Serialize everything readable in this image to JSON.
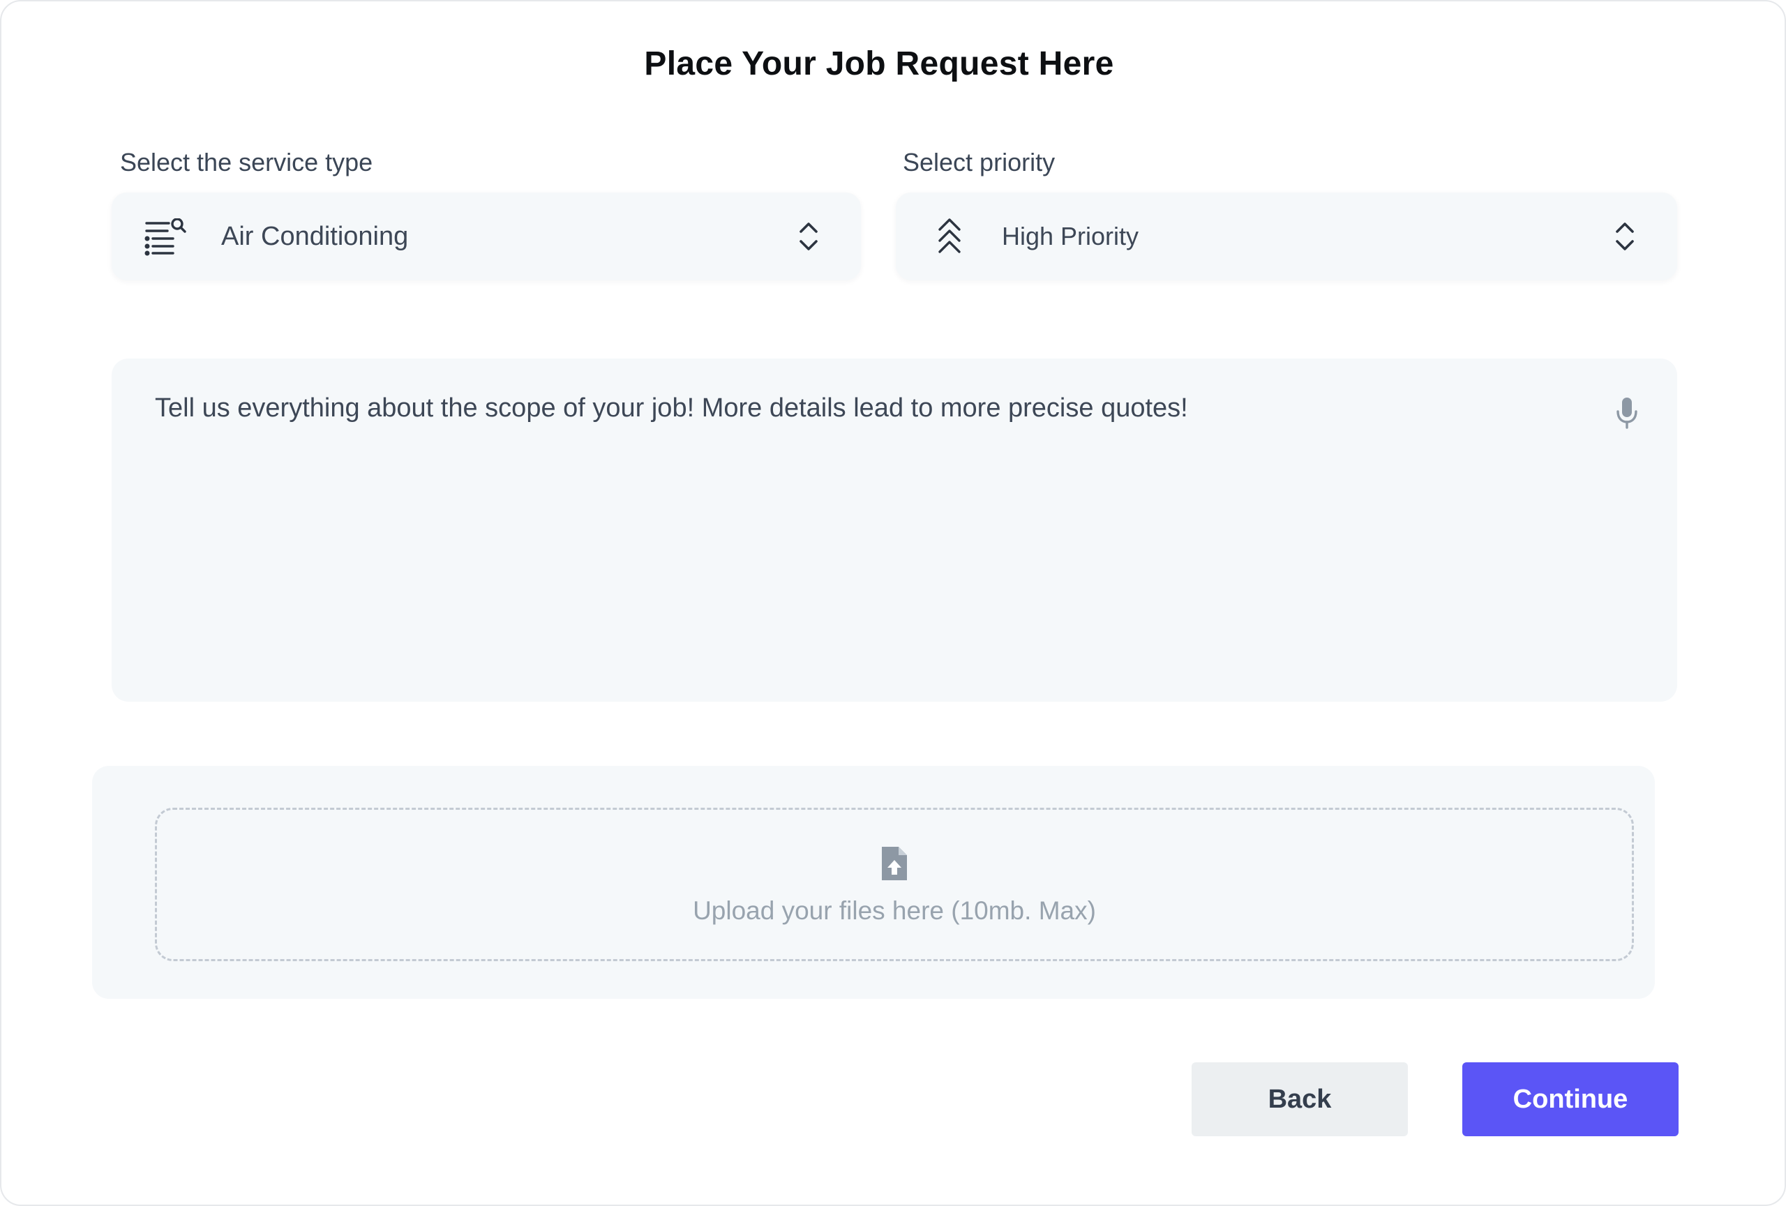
{
  "page": {
    "title": "Place Your Job Request Here"
  },
  "service_type": {
    "label": "Select the service type",
    "value": "Air Conditioning",
    "icon": "list-search-icon"
  },
  "priority": {
    "label": "Select priority",
    "value": "High Priority",
    "icon": "triple-chevron-up-icon"
  },
  "details": {
    "placeholder": "Tell us everything about the scope of your job! More details lead to more precise quotes!",
    "icon": "microphone-icon"
  },
  "upload": {
    "text": "Upload your files here (10mb. Max)",
    "icon": "file-upload-icon"
  },
  "actions": {
    "back_label": "Back",
    "continue_label": "Continue"
  },
  "colors": {
    "accent": "#5b55f6",
    "field_background": "#f5f8fa",
    "secondary_button": "#eceff1"
  }
}
